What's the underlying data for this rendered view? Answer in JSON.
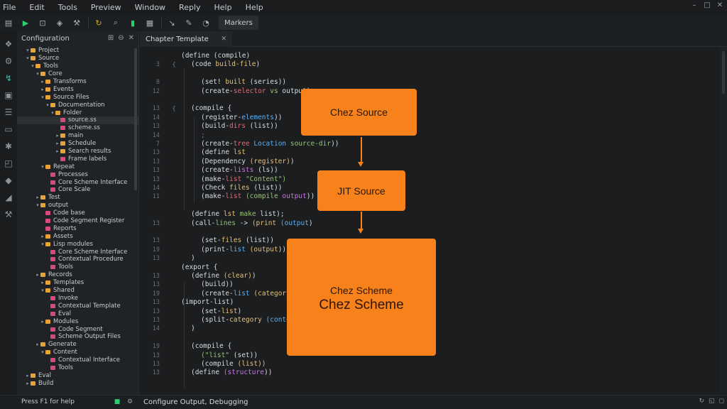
{
  "menu": [
    "File",
    "Edit",
    "Tools",
    "Preview",
    "Window",
    "Reply",
    "Help",
    "Help"
  ],
  "toolbar": {
    "icons": [
      "folder-icon",
      "run-icon",
      "save-icon",
      "debug-icon",
      "build-icon",
      "refresh-icon",
      "bar-chart-icon",
      "book-icon"
    ],
    "button_label": "Markers"
  },
  "explorer": {
    "title": "Configuration",
    "rows": [
      {
        "label": "Project",
        "indent": 1,
        "kind": "folder",
        "open": true
      },
      {
        "label": "Source",
        "indent": 1,
        "kind": "folder",
        "open": true
      },
      {
        "label": "Tools",
        "indent": 2,
        "kind": "folder",
        "open": true
      },
      {
        "label": "Core",
        "indent": 3,
        "kind": "folder",
        "open": true
      },
      {
        "label": "Transforms",
        "indent": 4,
        "kind": "folder"
      },
      {
        "label": "Events",
        "indent": 4,
        "kind": "folder"
      },
      {
        "label": "Source Files",
        "indent": 4,
        "kind": "folder",
        "open": true
      },
      {
        "label": "Documentation",
        "indent": 5,
        "kind": "folder",
        "open": true
      },
      {
        "label": "Folder",
        "indent": 6,
        "kind": "folder",
        "open": true
      },
      {
        "label": "source.ss",
        "indent": 7,
        "kind": "file",
        "selected": true
      },
      {
        "label": "scheme.ss",
        "indent": 7,
        "kind": "file"
      },
      {
        "label": "main",
        "indent": 7,
        "kind": "folder"
      },
      {
        "label": "Schedule",
        "indent": 7,
        "kind": "folder"
      },
      {
        "label": "Search results",
        "indent": 7,
        "kind": "folder"
      },
      {
        "label": "Frame labels",
        "indent": 7,
        "kind": "file"
      },
      {
        "label": "Repeat",
        "indent": 4,
        "kind": "folder",
        "open": true
      },
      {
        "label": "Processes",
        "indent": 5,
        "kind": "file"
      },
      {
        "label": "Core Scheme Interface",
        "indent": 5,
        "kind": "file"
      },
      {
        "label": "Core Scale",
        "indent": 5,
        "kind": "file"
      },
      {
        "label": "Test",
        "indent": 3,
        "kind": "folder"
      },
      {
        "label": "output",
        "indent": 3,
        "kind": "folder",
        "open": true
      },
      {
        "label": "Code base",
        "indent": 4,
        "kind": "file"
      },
      {
        "label": "Code Segment Register",
        "indent": 4,
        "kind": "file"
      },
      {
        "label": "Reports",
        "indent": 4,
        "kind": "file"
      },
      {
        "label": "Assets",
        "indent": 4,
        "kind": "folder"
      },
      {
        "label": "Lisp modules",
        "indent": 4,
        "kind": "folder",
        "open": true
      },
      {
        "label": "Core Scheme Interface",
        "indent": 5,
        "kind": "file"
      },
      {
        "label": "Contextual Procedure",
        "indent": 5,
        "kind": "file"
      },
      {
        "label": "Tools",
        "indent": 5,
        "kind": "file"
      },
      {
        "label": "Records",
        "indent": 3,
        "kind": "folder"
      },
      {
        "label": "Templates",
        "indent": 4,
        "kind": "folder"
      },
      {
        "label": "Shared",
        "indent": 4,
        "kind": "folder",
        "open": true
      },
      {
        "label": "Invoke",
        "indent": 5,
        "kind": "file"
      },
      {
        "label": "Contextual Template",
        "indent": 5,
        "kind": "file"
      },
      {
        "label": "Eval",
        "indent": 5,
        "kind": "file"
      },
      {
        "label": "Modules",
        "indent": 4,
        "kind": "folder"
      },
      {
        "label": "Code Segment",
        "indent": 5,
        "kind": "file"
      },
      {
        "label": "Scheme Output Files",
        "indent": 5,
        "kind": "file"
      },
      {
        "label": "Generate",
        "indent": 3,
        "kind": "folder"
      },
      {
        "label": "Content",
        "indent": 4,
        "kind": "folder",
        "open": true
      },
      {
        "label": "Contextual Interface",
        "indent": 5,
        "kind": "file"
      },
      {
        "label": "Tools",
        "indent": 5,
        "kind": "file"
      },
      {
        "label": "Eval",
        "indent": 1,
        "kind": "folder"
      },
      {
        "label": "Build",
        "indent": 1,
        "kind": "folder"
      }
    ]
  },
  "tab": {
    "label": "Chapter Template"
  },
  "editor": {
    "lines": [
      {
        "n": "",
        "fold": "",
        "indent": 0,
        "tokens": [
          {
            "t": "(define (compile)",
            "c": "#d8dde2"
          }
        ]
      },
      {
        "n": "3",
        "fold": "{",
        "indent": 1,
        "tokens": [
          {
            "t": "(code ",
            "c": "#d8dde2"
          },
          {
            "t": "build-file",
            "c": "#e5c07b"
          },
          {
            "t": ")",
            "c": "#d8dde2"
          }
        ]
      },
      {
        "n": "",
        "fold": "",
        "indent": 0,
        "tokens": []
      },
      {
        "n": "8",
        "fold": "",
        "indent": 2,
        "tokens": [
          {
            "t": "(set! ",
            "c": "#d8dde2"
          },
          {
            "t": "built",
            "c": "#e5c07b"
          },
          {
            "t": " (series))",
            "c": "#d8dde2"
          }
        ]
      },
      {
        "n": "12",
        "fold": "",
        "indent": 2,
        "tokens": [
          {
            "t": "(create-",
            "c": "#d8dde2"
          },
          {
            "t": "selector",
            "c": "#e06c75"
          },
          {
            "t": " vs ",
            "c": "#98c379"
          },
          {
            "t": "output",
            "c": "#d8dde2"
          },
          {
            "t": ")",
            "c": "#d8dde2"
          }
        ]
      },
      {
        "n": "",
        "fold": "",
        "indent": 0,
        "tokens": []
      },
      {
        "n": "13",
        "fold": "{",
        "indent": 1,
        "tokens": [
          {
            "t": "(compile {",
            "c": "#d8dde2"
          }
        ]
      },
      {
        "n": "14",
        "fold": "",
        "indent": 2,
        "tokens": [
          {
            "t": "(register-",
            "c": "#d8dde2"
          },
          {
            "t": "elements",
            "c": "#61afef"
          },
          {
            "t": "))",
            "c": "#d8dde2"
          }
        ]
      },
      {
        "n": "13",
        "fold": "",
        "indent": 2,
        "tokens": [
          {
            "t": "(build-",
            "c": "#d8dde2"
          },
          {
            "t": "dirs",
            "c": "#e06c75"
          },
          {
            "t": " (list))",
            "c": "#d8dde2"
          }
        ]
      },
      {
        "n": "14",
        "fold": "",
        "indent": 2,
        "tokens": [
          {
            "t": ";",
            "c": "#6b7177"
          }
        ]
      },
      {
        "n": "7",
        "fold": "",
        "indent": 2,
        "tokens": [
          {
            "t": "(create-",
            "c": "#d8dde2"
          },
          {
            "t": "tree ",
            "c": "#e06c75"
          },
          {
            "t": "Location ",
            "c": "#61afef"
          },
          {
            "t": "source-dir",
            "c": "#98c379"
          },
          {
            "t": "))",
            "c": "#d8dde2"
          }
        ]
      },
      {
        "n": "13",
        "fold": "",
        "indent": 2,
        "tokens": [
          {
            "t": "(define ",
            "c": "#d8dde2"
          },
          {
            "t": "lst",
            "c": "#e5c07b"
          }
        ]
      },
      {
        "n": "13",
        "fold": "",
        "indent": 2,
        "tokens": [
          {
            "t": "(Dependency ",
            "c": "#d8dde2"
          },
          {
            "t": "(register)",
            "c": "#e5c07b"
          },
          {
            "t": ")",
            "c": "#d8dde2"
          }
        ]
      },
      {
        "n": "13",
        "fold": "",
        "indent": 2,
        "tokens": [
          {
            "t": "(create-",
            "c": "#d8dde2"
          },
          {
            "t": "lists",
            "c": "#c678dd"
          },
          {
            "t": " (ls))",
            "c": "#d8dde2"
          }
        ]
      },
      {
        "n": "13",
        "fold": "",
        "indent": 2,
        "tokens": [
          {
            "t": "(make-",
            "c": "#d8dde2"
          },
          {
            "t": "list",
            "c": "#e06c75"
          },
          {
            "t": " \"Content\")",
            "c": "#98c379"
          }
        ]
      },
      {
        "n": "14",
        "fold": "",
        "indent": 2,
        "tokens": [
          {
            "t": "(Check ",
            "c": "#d8dde2"
          },
          {
            "t": "files",
            "c": "#e5c07b"
          },
          {
            "t": " (list))",
            "c": "#d8dde2"
          }
        ]
      },
      {
        "n": "11",
        "fold": "",
        "indent": 2,
        "tokens": [
          {
            "t": "(make-",
            "c": "#d8dde2"
          },
          {
            "t": "list ",
            "c": "#e06c75"
          },
          {
            "t": "(compile ",
            "c": "#98c379"
          },
          {
            "t": "output",
            "c": "#c678dd"
          },
          {
            "t": "))",
            "c": "#d8dde2"
          }
        ]
      },
      {
        "n": "",
        "fold": "",
        "indent": 0,
        "tokens": []
      },
      {
        "n": "",
        "fold": "",
        "indent": 1,
        "tokens": [
          {
            "t": "(define ",
            "c": "#d8dde2"
          },
          {
            "t": "lst ",
            "c": "#e5c07b"
          },
          {
            "t": "make ",
            "c": "#98c379"
          },
          {
            "t": "list",
            "c": "#d8dde2"
          },
          {
            "t": ");",
            "c": "#d8dde2"
          }
        ]
      },
      {
        "n": "13",
        "fold": "",
        "indent": 1,
        "tokens": [
          {
            "t": "(call-",
            "c": "#d8dde2"
          },
          {
            "t": "lines",
            "c": "#98c379"
          },
          {
            "t": " -> ",
            "c": "#d8dde2"
          },
          {
            "t": "(print",
            "c": "#e5c07b"
          },
          {
            "t": " (output",
            "c": "#61afef"
          },
          {
            "t": ")",
            "c": "#d8dde2"
          }
        ]
      },
      {
        "n": "",
        "fold": "",
        "indent": 0,
        "tokens": []
      },
      {
        "n": "13",
        "fold": "",
        "indent": 2,
        "tokens": [
          {
            "t": "(set-",
            "c": "#d8dde2"
          },
          {
            "t": "files",
            "c": "#e5c07b"
          },
          {
            "t": " (list))",
            "c": "#d8dde2"
          }
        ]
      },
      {
        "n": "19",
        "fold": "",
        "indent": 2,
        "tokens": [
          {
            "t": "(print-",
            "c": "#d8dde2"
          },
          {
            "t": "list ",
            "c": "#61afef"
          },
          {
            "t": "(output",
            "c": "#e5c07b"
          },
          {
            "t": "))",
            "c": "#d8dde2"
          }
        ]
      },
      {
        "n": "13",
        "fold": "",
        "indent": 1,
        "tokens": [
          {
            "t": ")",
            "c": "#d8dde2"
          }
        ]
      },
      {
        "n": "",
        "fold": "",
        "indent": 0,
        "tokens": [
          {
            "t": "(export {",
            "c": "#d8dde2"
          }
        ]
      },
      {
        "n": "13",
        "fold": "",
        "indent": 1,
        "tokens": [
          {
            "t": "(define ",
            "c": "#d8dde2"
          },
          {
            "t": "(clear)",
            "c": "#e5c07b"
          },
          {
            "t": ")",
            "c": "#d8dde2"
          }
        ]
      },
      {
        "n": "13",
        "fold": "",
        "indent": 2,
        "tokens": [
          {
            "t": "(build))",
            "c": "#d8dde2"
          }
        ]
      },
      {
        "n": "19",
        "fold": "",
        "indent": 2,
        "tokens": [
          {
            "t": "(create-",
            "c": "#d8dde2"
          },
          {
            "t": "list ",
            "c": "#61afef"
          },
          {
            "t": "(category",
            "c": "#e5c07b"
          },
          {
            "t": ")",
            "c": "#d8dde2"
          }
        ]
      },
      {
        "n": "13",
        "fold": "",
        "indent": 0,
        "tokens": [
          {
            "t": "(import-list)",
            "c": "#d8dde2"
          }
        ]
      },
      {
        "n": "13",
        "fold": "",
        "indent": 2,
        "tokens": [
          {
            "t": "(set-",
            "c": "#d8dde2"
          },
          {
            "t": "list",
            "c": "#e5c07b"
          },
          {
            "t": ")",
            "c": "#d8dde2"
          }
        ]
      },
      {
        "n": "13",
        "fold": "",
        "indent": 2,
        "tokens": [
          {
            "t": "(split-",
            "c": "#d8dde2"
          },
          {
            "t": "category ",
            "c": "#e5c07b"
          },
          {
            "t": "(content",
            "c": "#61afef"
          },
          {
            "t": "))",
            "c": "#d8dde2"
          }
        ]
      },
      {
        "n": "14",
        "fold": "",
        "indent": 1,
        "tokens": [
          {
            "t": ")",
            "c": "#d8dde2"
          }
        ]
      },
      {
        "n": "",
        "fold": "",
        "indent": 0,
        "tokens": []
      },
      {
        "n": "19",
        "fold": "",
        "indent": 1,
        "tokens": [
          {
            "t": "(compile {",
            "c": "#d8dde2"
          }
        ]
      },
      {
        "n": "13",
        "fold": "",
        "indent": 2,
        "tokens": [
          {
            "t": "(\"list\" ",
            "c": "#98c379"
          },
          {
            "t": "(set))",
            "c": "#d8dde2"
          }
        ]
      },
      {
        "n": "13",
        "fold": "",
        "indent": 2,
        "tokens": [
          {
            "t": "(compile ",
            "c": "#d8dde2"
          },
          {
            "t": "(list))",
            "c": "#e5c07b"
          }
        ]
      },
      {
        "n": "13",
        "fold": "",
        "indent": 1,
        "tokens": [
          {
            "t": "(define ",
            "c": "#d8dde2"
          },
          {
            "t": "(structure",
            "c": "#c678dd"
          },
          {
            "t": "))",
            "c": "#d8dde2"
          }
        ]
      }
    ]
  },
  "diagram": {
    "box1": "Chez Source",
    "box2": "JIT Source",
    "box3_small": "Chez Scheme",
    "box3_large": "Chez Scheme"
  },
  "status": {
    "left": "Press F1 for help",
    "middle": "Configure Output, Debugging"
  },
  "colors": {
    "accent": "#f7821b",
    "background": "#1b1d1f",
    "run": "#2ecc71"
  }
}
